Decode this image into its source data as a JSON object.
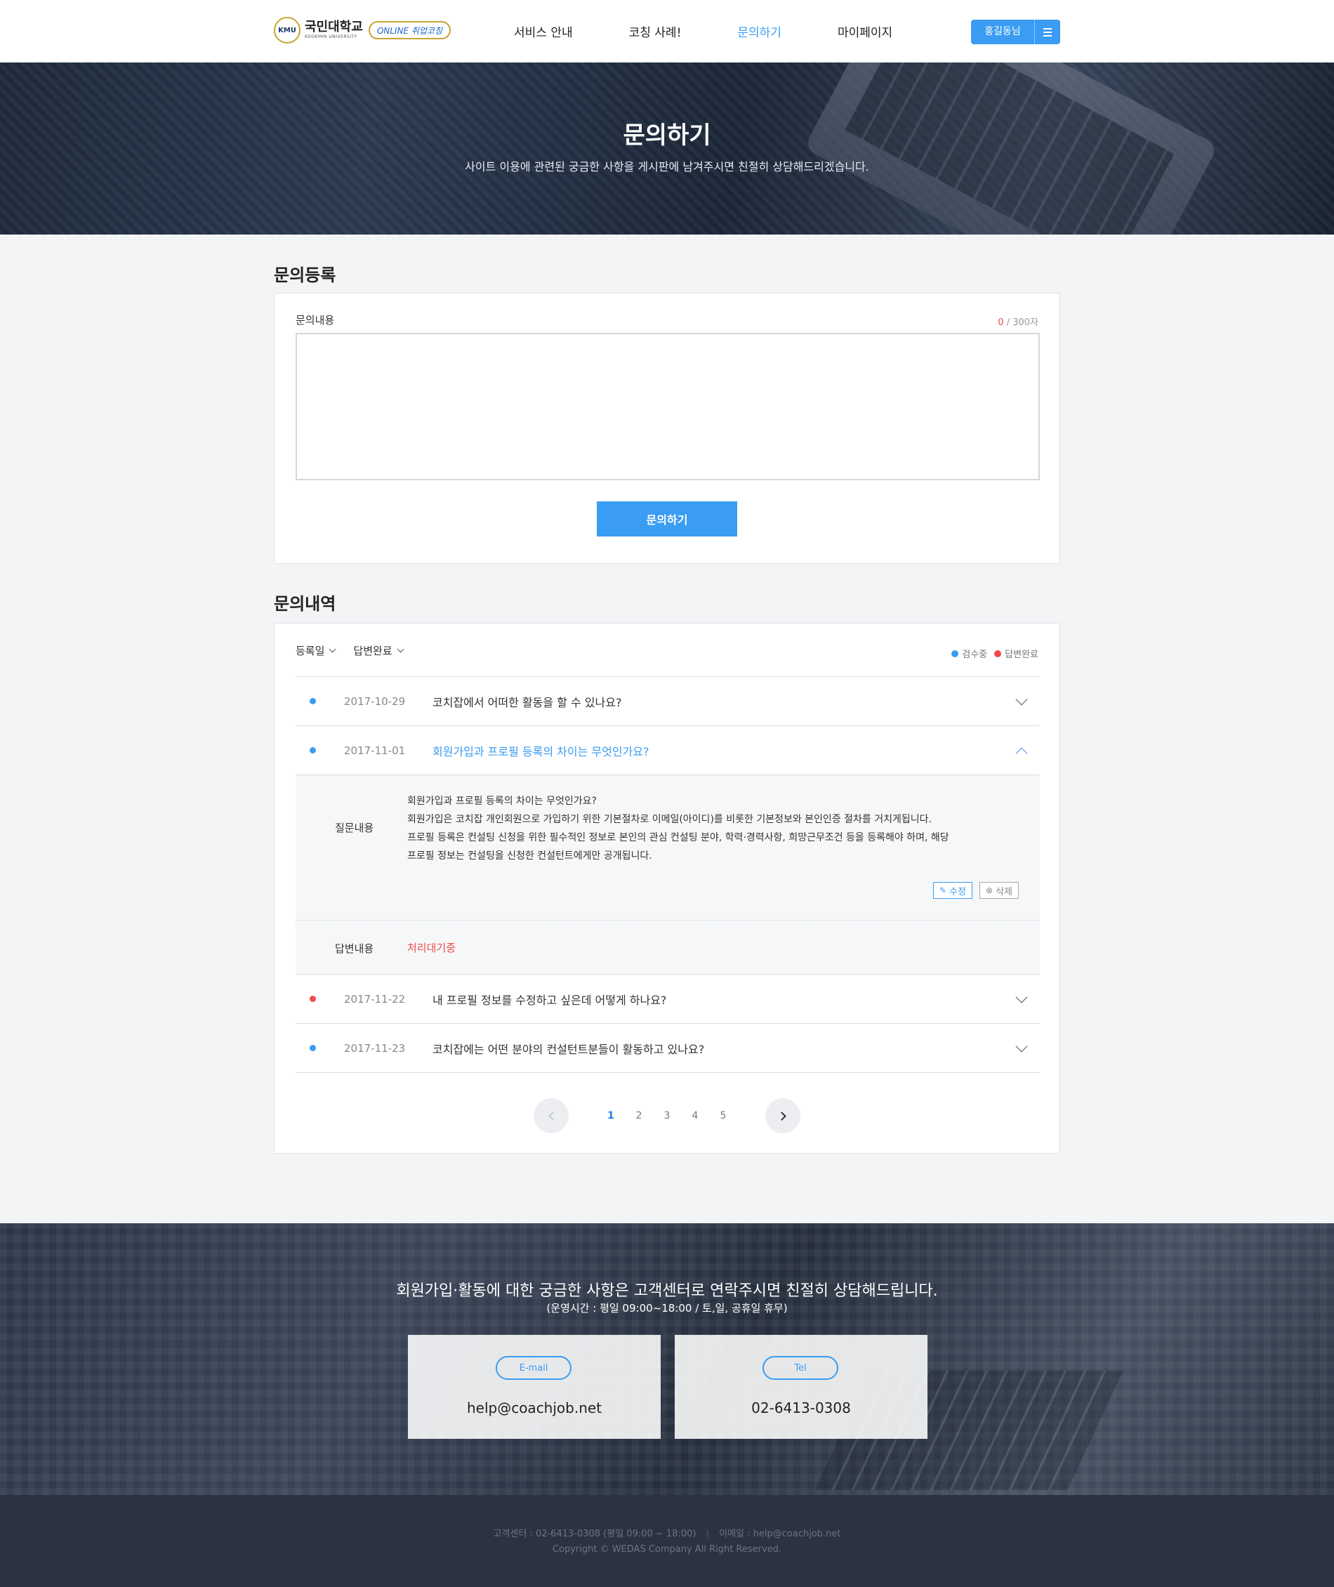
{
  "header": {
    "logo_emblem": "KMU",
    "logo_title": "국민대학교",
    "logo_subtitle": "KOOKMIN UNIVERSITY",
    "logo_badge": "ONLINE 취업코칭",
    "nav": [
      {
        "label": "서비스 안내",
        "active": false
      },
      {
        "label": "코칭 사례!",
        "active": false
      },
      {
        "label": "문의하기",
        "active": true
      },
      {
        "label": "마이페이지",
        "active": false
      }
    ],
    "user_label": "홍길동님",
    "menu_icon": "hamburger-icon"
  },
  "hero": {
    "title": "문의하기",
    "subtitle": "사이트 이용에 관련된 궁금한 사항을 게시판에 남겨주시면 친절히 상담해드리겠습니다."
  },
  "register": {
    "section_title": "문의등록",
    "field_label": "문의내용",
    "char_count": "0",
    "char_limit": "/ 300자",
    "textarea_value": "",
    "submit_label": "문의하기"
  },
  "history": {
    "section_title": "문의내역",
    "filters": [
      "등록일",
      "답변완료"
    ],
    "legend": [
      {
        "label": "검수중",
        "color": "#3a9cf2"
      },
      {
        "label": "답변완료",
        "color": "#f04b4b"
      }
    ],
    "rows": [
      {
        "status": "blue",
        "date": "2017-10-29",
        "question": "코치잡에서 어떠한 활동을 할 수 있나요?",
        "open": false
      },
      {
        "status": "blue",
        "date": "2017-11-01",
        "question": "회원가입과 프로필 등록의 차이는 무엇인가요?",
        "open": true
      },
      {
        "status": "red",
        "date": "2017-11-22",
        "question": "내 프로필 정보를 수정하고 싶은데 어떻게 하나요?",
        "open": false
      },
      {
        "status": "blue",
        "date": "2017-11-23",
        "question": "코치잡에는 어떤 분야의 컨설턴트분들이 활동하고 있나요?",
        "open": false
      }
    ],
    "detail": {
      "question_label": "질문내용",
      "question_lines": [
        "회원가입과 프로필 등록의 차이는 무엇인가요?",
        "회원가입은 코치잡 개인회원으로 가입하기 위한 기본절차로 이메일(아이디)를 비롯한 기본정보와 본인인증 절차를 거치게됩니다.",
        "프로필 등록은 컨설팅 신청을 위한 필수적인 정보로 본인의 관심 컨설팅 분야, 학력·경력사항, 희망근무조건 등을 등록해야 하며, 해당",
        "프로필 정보는 컨설팅을 신청한 컨설턴트에게만 공개됩니다."
      ],
      "edit_label": "수정",
      "delete_label": "삭제",
      "answer_label": "답변내용",
      "answer_value": "처리대기중"
    },
    "pagination": {
      "pages": [
        "1",
        "2",
        "3",
        "4",
        "5"
      ],
      "current": "1"
    }
  },
  "contact": {
    "title": "회원가입·활동에 대한 궁금한 사항은 고객센터로 연락주시면 친절히 상담해드립니다.",
    "subtitle": "(운영시간 : 평일 09:00~18:00 / 토,일, 공휴일 휴무)",
    "email_tag": "E-mail",
    "email_value": "help@coachjob.net",
    "tel_tag": "Tel",
    "tel_value": "02-6413-0308"
  },
  "footer": {
    "center": "고객센터 : 02-6413-0308 (평일 09:00 ~ 18:00)",
    "separator": "|",
    "email": "이메일 : help@coachjob.net",
    "copyright": "Copyright © WEDAS Company All Right Reserved."
  }
}
